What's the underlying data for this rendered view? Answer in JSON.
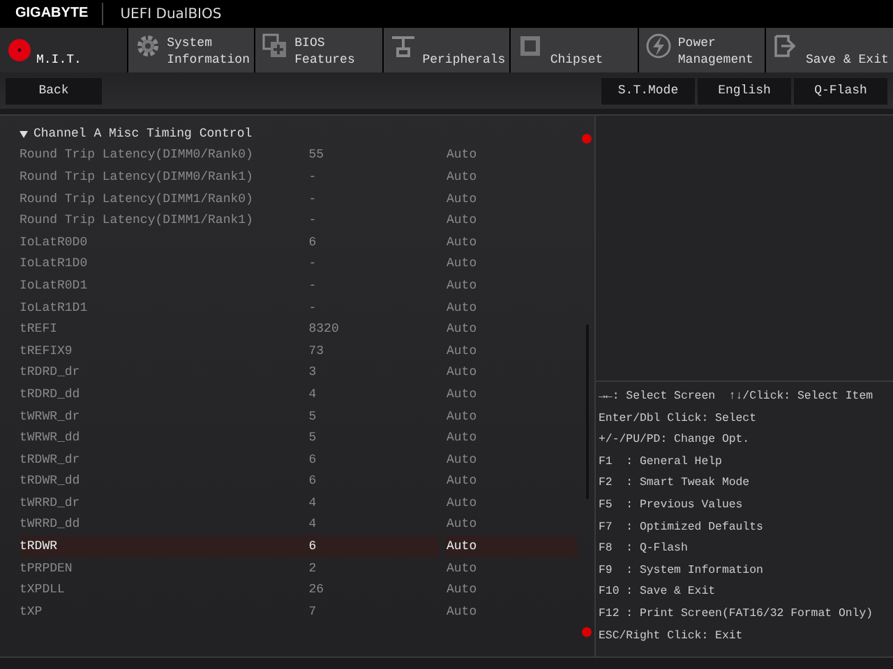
{
  "header": {
    "brand": "GIGABYTE",
    "title": "UEFI DualBIOS"
  },
  "tabs": [
    {
      "label": "M.I.T.",
      "selected": true
    },
    {
      "label": "System Information",
      "selected": false
    },
    {
      "label": "BIOS Features",
      "selected": false
    },
    {
      "label": "Peripherals",
      "selected": false
    },
    {
      "label": "Chipset",
      "selected": false
    },
    {
      "label": "Power Management",
      "selected": false
    },
    {
      "label": "Save & Exit",
      "selected": false
    }
  ],
  "toolbar": {
    "left": [
      "Back"
    ],
    "right": [
      "S.T.Mode",
      "English",
      "Q-Flash"
    ]
  },
  "section": {
    "title": "Channel A Misc Timing Control",
    "expanded": true
  },
  "settings": [
    {
      "name": "Round Trip Latency(DIMM0/Rank0)",
      "value": "55",
      "option": "Auto",
      "selected": false
    },
    {
      "name": "Round Trip Latency(DIMM0/Rank1)",
      "value": "-",
      "option": "Auto",
      "selected": false
    },
    {
      "name": "Round Trip Latency(DIMM1/Rank0)",
      "value": "-",
      "option": "Auto",
      "selected": false
    },
    {
      "name": "Round Trip Latency(DIMM1/Rank1)",
      "value": "-",
      "option": "Auto",
      "selected": false
    },
    {
      "name": "IoLatR0D0",
      "value": "6",
      "option": "Auto",
      "selected": false
    },
    {
      "name": "IoLatR1D0",
      "value": "-",
      "option": "Auto",
      "selected": false
    },
    {
      "name": "IoLatR0D1",
      "value": "-",
      "option": "Auto",
      "selected": false
    },
    {
      "name": "IoLatR1D1",
      "value": "-",
      "option": "Auto",
      "selected": false
    },
    {
      "name": "tREFI",
      "value": "8320",
      "option": "Auto",
      "selected": false
    },
    {
      "name": "tREFIX9",
      "value": "73",
      "option": "Auto",
      "selected": false
    },
    {
      "name": "tRDRD_dr",
      "value": "3",
      "option": "Auto",
      "selected": false
    },
    {
      "name": "tRDRD_dd",
      "value": "4",
      "option": "Auto",
      "selected": false
    },
    {
      "name": "tWRWR_dr",
      "value": "5",
      "option": "Auto",
      "selected": false
    },
    {
      "name": "tWRWR_dd",
      "value": "5",
      "option": "Auto",
      "selected": false
    },
    {
      "name": "tRDWR_dr",
      "value": "6",
      "option": "Auto",
      "selected": false
    },
    {
      "name": "tRDWR_dd",
      "value": "6",
      "option": "Auto",
      "selected": false
    },
    {
      "name": "tWRRD_dr",
      "value": "4",
      "option": "Auto",
      "selected": false
    },
    {
      "name": "tWRRD_dd",
      "value": "4",
      "option": "Auto",
      "selected": false
    },
    {
      "name": "tRDWR",
      "value": "6",
      "option": "Auto",
      "selected": true
    },
    {
      "name": "tPRPDEN",
      "value": "2",
      "option": "Auto",
      "selected": false
    },
    {
      "name": "tXPDLL",
      "value": "26",
      "option": "Auto",
      "selected": false
    },
    {
      "name": "tXP",
      "value": "7",
      "option": "Auto",
      "selected": false
    }
  ],
  "help": [
    "→←: Select Screen  ↑↓/Click: Select Item",
    "Enter/Dbl Click: Select",
    "+/-/PU/PD: Change Opt.",
    "F1  : General Help",
    "F2  : Smart Tweak Mode",
    "F5  : Previous Values",
    "F7  : Optimized Defaults",
    "F8  : Q-Flash",
    "F9  : System Information",
    "F10 : Save & Exit",
    "F12 : Print Screen(FAT16/32 Format Only)",
    "ESC/Right Click: Exit"
  ]
}
